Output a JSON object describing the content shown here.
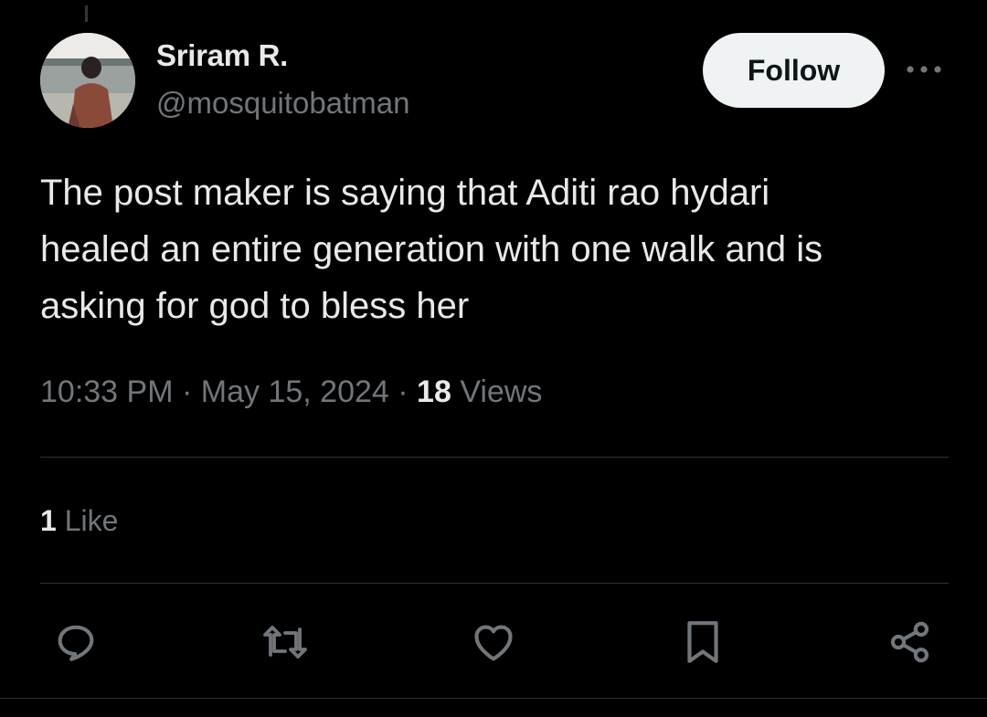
{
  "author": {
    "display_name": "Sriram R.",
    "handle": "@mosquitobatman",
    "avatar": "avatar-photo"
  },
  "follow_label": "Follow",
  "more_icon": "more-horizontal-icon",
  "tweet": {
    "text": "The post maker is saying that Aditi rao hydari\nhealed an entire generation with one walk and is\nasking for god to bless her",
    "time": "10:33 PM",
    "separator": "·",
    "date": "May 15, 2024",
    "views_count": "18",
    "views_label": "Views"
  },
  "engagement": {
    "like_count": "1",
    "like_label": "Like"
  },
  "actions": [
    "reply-icon",
    "retweet-icon",
    "like-icon",
    "bookmark-icon",
    "share-icon"
  ],
  "colors": {
    "background": "#000000",
    "primary_text": "#e7e9ea",
    "secondary_text": "#71767b",
    "follow_bg": "#eff3f4",
    "divider": "#2f3336"
  }
}
